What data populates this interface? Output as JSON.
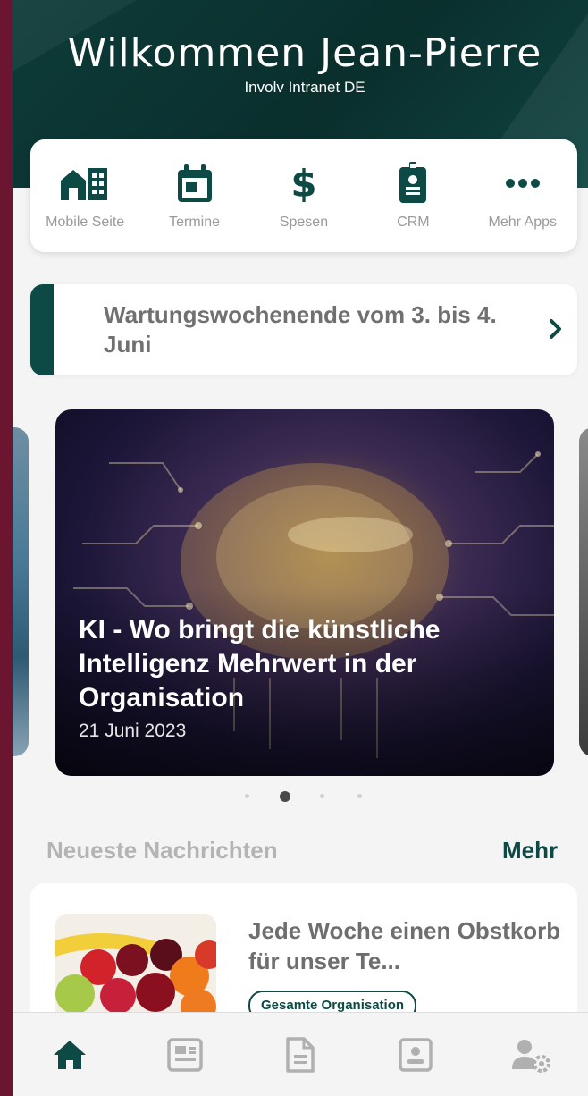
{
  "header": {
    "welcome": "Wilkommen Jean-Pierre",
    "subtitle": "Involv Intranet DE"
  },
  "apps": [
    {
      "label": "Mobile Seite",
      "icon": "buildings-icon"
    },
    {
      "label": "Termine",
      "icon": "calendar-icon"
    },
    {
      "label": "Spesen",
      "icon": "dollar-icon"
    },
    {
      "label": "CRM",
      "icon": "id-badge-icon"
    },
    {
      "label": "Mehr Apps",
      "icon": "more-dots-icon"
    }
  ],
  "notice": {
    "text": "Wartungswochenende vom 3. bis 4. Juni"
  },
  "carousel": {
    "title": "KI - Wo bringt die künstliche Intelligenz Mehrwert in der Organisation",
    "date": "21 Juni 2023",
    "page_count": 4,
    "active_index": 1
  },
  "news_section": {
    "title": "Neueste Nachrichten",
    "more": "Mehr"
  },
  "news": [
    {
      "title": "Jede Woche einen Obstkorb für unser Te...",
      "tag": "Gesamte Organisation"
    }
  ],
  "tabbar": [
    {
      "icon": "home-icon",
      "active": true
    },
    {
      "icon": "news-icon",
      "active": false
    },
    {
      "icon": "document-icon",
      "active": false
    },
    {
      "icon": "contact-card-icon",
      "active": false
    },
    {
      "icon": "user-settings-icon",
      "active": false
    }
  ],
  "colors": {
    "accent": "#0e4a45",
    "frame": "#6b1530",
    "inactive": "#b0b0b0"
  }
}
